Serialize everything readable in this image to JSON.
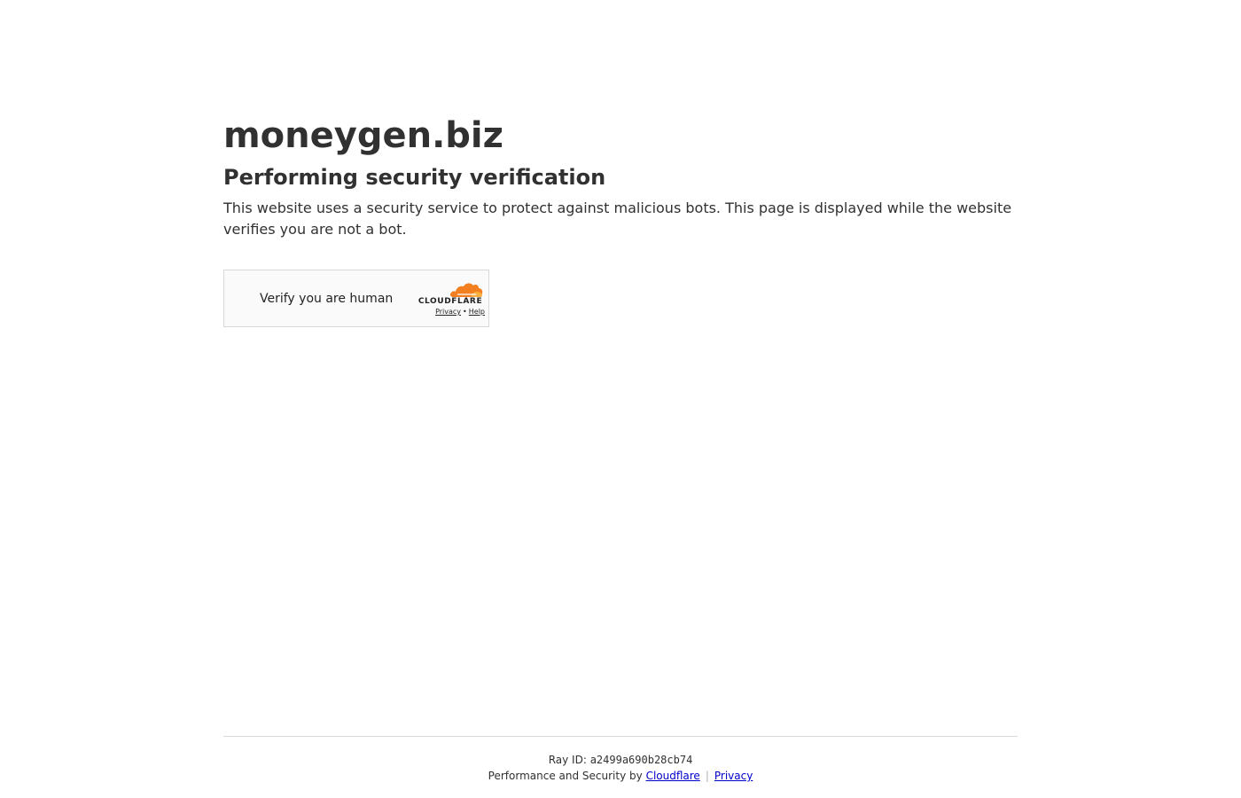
{
  "site": {
    "name": "moneygen.biz"
  },
  "challenge": {
    "heading": "Performing security verification",
    "description": "This website uses a security service to protect against malicious bots. This page is displayed while the website verifies you are not a bot."
  },
  "widget": {
    "label": "Verify you are human",
    "brand": "CLOUDFLARE",
    "privacy_link": "Privacy",
    "separator": "•",
    "help_link": "Help",
    "cloud_icon": "cloudflare-cloud-icon",
    "brand_color": "#f38020"
  },
  "footer": {
    "ray_label": "Ray ID:",
    "ray_id": "a2499a690b28cb74",
    "performance_text": "Performance and Security by",
    "cloudflare_link": "Cloudflare",
    "separator": "|",
    "privacy_link": "Privacy",
    "link_color": "#0000cc"
  }
}
